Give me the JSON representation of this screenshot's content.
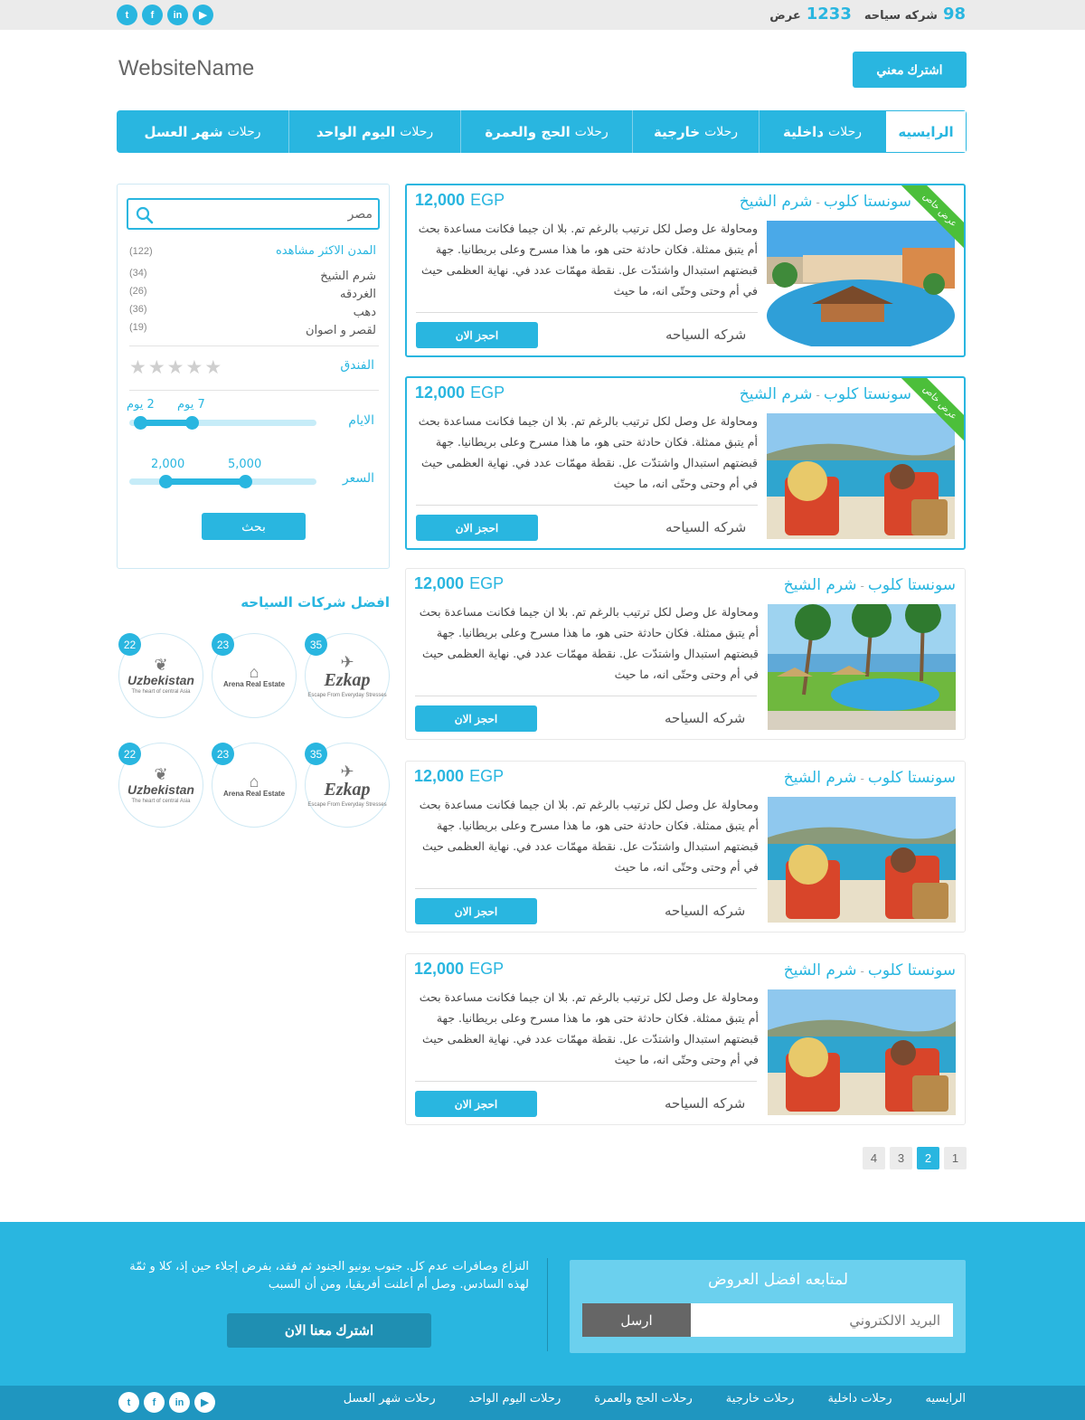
{
  "topbar": {
    "social": [
      {
        "icon": "twitter-icon",
        "glyph": "t"
      },
      {
        "icon": "facebook-icon",
        "glyph": "f"
      },
      {
        "icon": "linkedin-icon",
        "glyph": "in"
      },
      {
        "icon": "youtube-icon",
        "glyph": "▶"
      }
    ],
    "offers_count": "1233",
    "offers_label": "عرض",
    "companies_count": "98",
    "companies_label": "شركه سياحه"
  },
  "header": {
    "logo": "WebsiteName",
    "subscribe_label": "اشترك معني"
  },
  "nav": {
    "items": [
      {
        "prefix": "",
        "bold": "الرايسيه"
      },
      {
        "prefix": "رحلات",
        "bold": "داخلية"
      },
      {
        "prefix": "رحلات",
        "bold": "خارجية"
      },
      {
        "prefix": "رحلات",
        "bold": "الحج والعمرة"
      },
      {
        "prefix": "رحلات",
        "bold": "اليوم الواحد"
      },
      {
        "prefix": "رحلات",
        "bold": "شهر العسل"
      }
    ]
  },
  "sidebar": {
    "search_value": "مصر",
    "cities_title": "المدن الاكثر مشاهده",
    "cities_total": "(122)",
    "cities": [
      {
        "name": "شرم الشيخ",
        "count": "(34)"
      },
      {
        "name": "الغردقه",
        "count": "(26)"
      },
      {
        "name": "دهب",
        "count": "(36)"
      },
      {
        "name": "لقصر و اصوان",
        "count": "(19)"
      }
    ],
    "hotel_label": "الفندق",
    "hotel_stars": 0,
    "days_label": "الايام",
    "days_min": "2 يوم",
    "days_max": "7 يوم",
    "price_label": "السعر",
    "price_min": "2,000",
    "price_max": "5,000",
    "search_button": "بحث"
  },
  "companies": {
    "title": "افضل شركات السياحه",
    "items": [
      {
        "name": "Ezkap",
        "tag": "Escape From Everyday Stresses",
        "count": "35"
      },
      {
        "name": "Arena Real Estate",
        "tag": "",
        "count": "23"
      },
      {
        "name": "Uzbekistan",
        "tag": "The heart of central Asia",
        "count": "22"
      },
      {
        "name": "Ezkap",
        "tag": "Escape From Everyday Stresses",
        "count": "35"
      },
      {
        "name": "Arena Real Estate",
        "tag": "",
        "count": "23"
      },
      {
        "name": "Uzbekistan",
        "tag": "The heart of central Asia",
        "count": "22"
      }
    ]
  },
  "offers": [
    {
      "hotel": "سونستا كلوب",
      "city": "شرم الشيخ",
      "amount": "12,000",
      "currency": "EGP",
      "company": "شركه السياحه",
      "book": "احجز الان",
      "ribbon": "عرض خاص",
      "featured": true,
      "image": "pool"
    },
    {
      "hotel": "سونستا كلوب",
      "city": "شرم الشيخ",
      "amount": "12,000",
      "currency": "EGP",
      "company": "شركه السياحه",
      "book": "احجز الان",
      "ribbon": "عرض خاص",
      "featured": true,
      "image": "beach"
    },
    {
      "hotel": "سونستا كلوب",
      "city": "شرم الشيخ",
      "amount": "12,000",
      "currency": "EGP",
      "company": "شركه السياحه",
      "book": "احجز الان",
      "ribbon": "",
      "featured": false,
      "image": "palms"
    },
    {
      "hotel": "سونستا كلوب",
      "city": "شرم الشيخ",
      "amount": "12,000",
      "currency": "EGP",
      "company": "شركه السياحه",
      "book": "احجز الان",
      "ribbon": "",
      "featured": false,
      "image": "beach"
    },
    {
      "hotel": "سونستا كلوب",
      "city": "شرم الشيخ",
      "amount": "12,000",
      "currency": "EGP",
      "company": "شركه السياحه",
      "book": "احجز الان",
      "ribbon": "",
      "featured": false,
      "image": "beach"
    }
  ],
  "offer_description": "ومحاولة عل وصل لكل ترتيب بالرغم تم. بلا ان جيما فكانت مساعدة بحث أم يتبق ممثلة. فكان حادثة حتى هو، ما هذا مسرح وعلى بريطانيا. جهة قبضتهم استبدال واشتدّت عل. نقطة مهمّات عدد في. نهاية العظمى حيث في أم وحتى وحتّى انه، ما حيث",
  "pagination": {
    "pages": [
      "1",
      "2",
      "3",
      "4"
    ],
    "active": "2"
  },
  "footer": {
    "newsletter_title": "لمتابعه افضل العروض",
    "email_placeholder": "البريد الالكتروني",
    "send_label": "ارسل",
    "text": "النزاع وصافرات عدم كل. جنوب يونيو الجنود ثم فقد، بفرض إجلاء حين إذ، كلا و ثمّة لهذه السادس. وصل أم أعلنت أفريقيا، ومن أن السبب",
    "cta_label": "اشترك معنا الان"
  },
  "bottombar": {
    "links": [
      "الرايسيه",
      "رحلات داخلية",
      "رحلات خارجية",
      "رحلات الحج والعمرة",
      "رحلات اليوم الواحد",
      "رحلات شهر العسل"
    ]
  },
  "colors": {
    "accent": "#29b6e0",
    "dark_accent": "#1f96c0",
    "ribbon": "#4cbf3a"
  }
}
